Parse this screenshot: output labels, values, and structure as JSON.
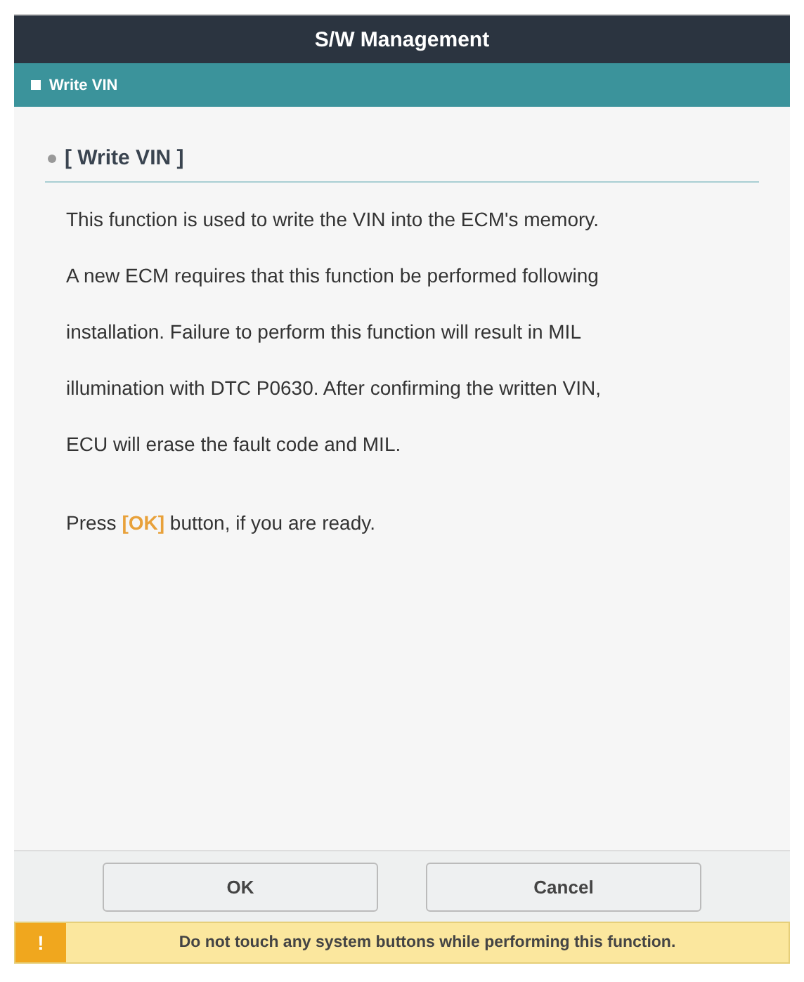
{
  "window": {
    "title": "S/W Management"
  },
  "section_bar": {
    "label": "Write VIN"
  },
  "heading": "[ Write VIN ]",
  "paragraphs": [
    {
      "lines": [
        "This function is used to write the VIN into the ECM's memory."
      ]
    },
    {
      "lines": [
        "A new ECM requires that this function be performed following",
        "installation. Failure to perform this function will result in MIL",
        "illumination with DTC P0630. After confirming the written VIN,",
        "ECU will erase the fault code and MIL."
      ]
    }
  ],
  "prompt": [
    {
      "kind": "plain",
      "text": "Press "
    },
    {
      "kind": "highlight",
      "text": "[OK]"
    },
    {
      "kind": "plain",
      "text": " button, if you are ready."
    }
  ],
  "buttons": [
    "OK",
    "Cancel"
  ],
  "warning": {
    "icon": "!",
    "text": "Do not touch any system buttons while performing this function."
  }
}
